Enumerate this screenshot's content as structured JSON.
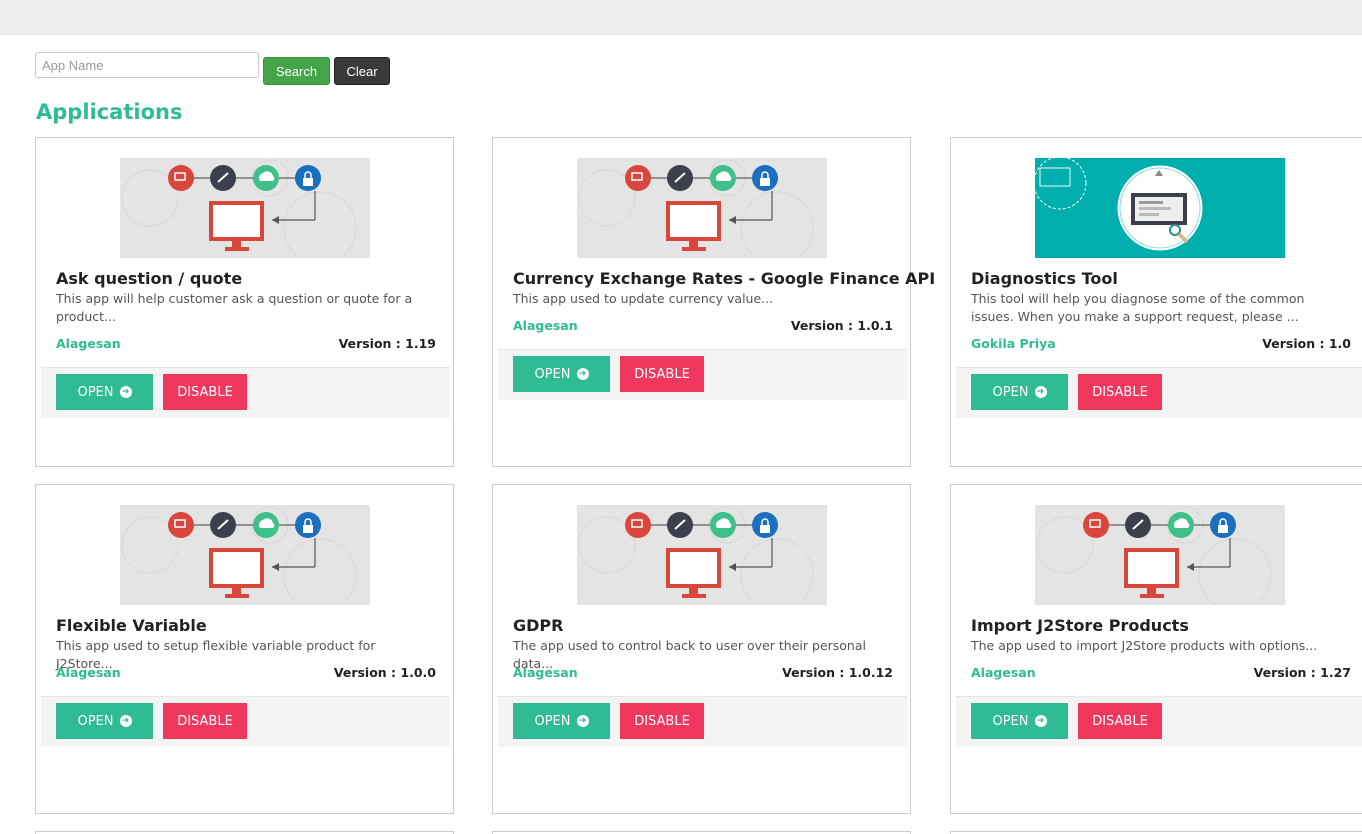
{
  "search": {
    "placeholder": "App Name",
    "value": "",
    "search_label": "Search",
    "clear_label": "Clear"
  },
  "section_title": "Applications",
  "colors": {
    "accent": "#2fbb94",
    "danger": "#f0375e",
    "search_button": "#44a548",
    "clear_button": "#3a3a3a"
  },
  "apps": [
    {
      "title": "Ask question / quote",
      "description": "This app will help customer ask a question or quote for a product...",
      "author": "Alagesan",
      "version": "Version : 1.19",
      "open_label": "OPEN",
      "disable_label": "DISABLE",
      "image": "app-flow-icons"
    },
    {
      "title": "Currency Exchange Rates - Google Finance API",
      "description": "This app used to update currency value...",
      "author": "Alagesan",
      "version": "Version : 1.0.1",
      "open_label": "OPEN",
      "disable_label": "DISABLE",
      "image": "app-flow-icons"
    },
    {
      "title": "Diagnostics Tool",
      "description": "This tool will help you diagnose some of the common issues. When you make a support request, please ...",
      "author": "Gokila Priya",
      "version": "Version : 1.0",
      "open_label": "OPEN",
      "disable_label": "DISABLE",
      "image": "diagnostics-screen"
    },
    {
      "title": "Flexible Variable",
      "description": "This app used to setup flexible variable product for J2Store...",
      "author": "Alagesan",
      "version": "Version : 1.0.0",
      "open_label": "OPEN",
      "disable_label": "DISABLE",
      "image": "app-flow-icons"
    },
    {
      "title": "GDPR",
      "description": "The app used to control back to user over their personal data...",
      "author": "Alagesan",
      "version": "Version : 1.0.12",
      "open_label": "OPEN",
      "disable_label": "DISABLE",
      "image": "app-flow-icons"
    },
    {
      "title": "Import J2Store Products",
      "description": "The app used to import J2Store products with options...",
      "author": "Alagesan",
      "version": "Version : 1.27",
      "open_label": "OPEN",
      "disable_label": "DISABLE",
      "image": "app-flow-icons"
    }
  ]
}
